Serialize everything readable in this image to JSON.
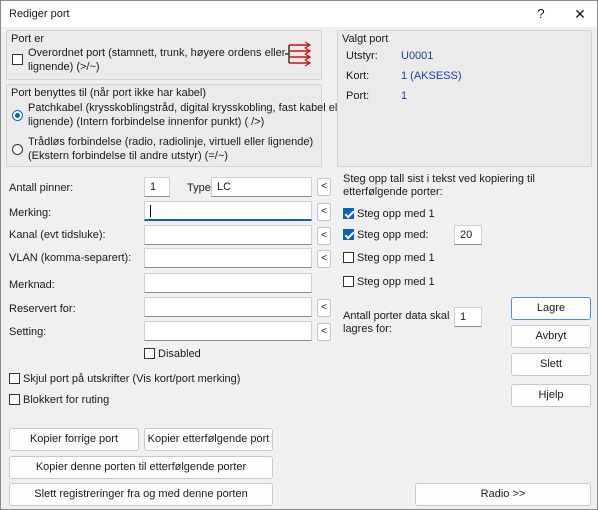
{
  "window": {
    "title": "Rediger port",
    "help": "?",
    "close": "✕"
  },
  "port_er": {
    "legend": "Port er",
    "overordnet_label": "Overordnet port (stamnett, trunk, høyere ordens eller lignende) (>/~)",
    "overordnet_line1": "Overordnet port (stamnett, trunk, høyere ordens eller",
    "overordnet_line2": "lignende) (>/~)"
  },
  "benyttes": {
    "legend": "Port benyttes til (når port ikke har kabel)",
    "patch_line1": "Patchkabel (krysskoblingstråd, digital krysskobling, fast kabel eller",
    "patch_line2": "lignende) (Intern forbindelse innenfor punkt) ( />)",
    "wireless_line1": "Trådløs forbindelse (radio, radiolinje, virtuell eller lignende)",
    "wireless_line2": "(Ekstern forbindelse til andre utstyr) (=/~)",
    "selected": "patch"
  },
  "valgt_port": {
    "legend": "Valgt port",
    "utstyr_label": "Utstyr:",
    "utstyr_value": "U0001",
    "kort_label": "Kort:",
    "kort_value": "1  (AKSESS)",
    "port_label": "Port:",
    "port_value": "1"
  },
  "fields": {
    "antall_pinner_label": "Antall pinner:",
    "antall_pinner_value": "1",
    "type_label": "Type:",
    "type_value": "LC",
    "merking_label": "Merking:",
    "merking_value": "",
    "kanal_label": "Kanal (evt tidsluke):",
    "kanal_value": "",
    "vlan_label": "VLAN (komma-separert):",
    "vlan_value": "",
    "merknad_label": "Merknad:",
    "merknad_value": "",
    "reservert_label": "Reservert for:",
    "reservert_value": "",
    "setting_label": "Setting:",
    "setting_value": "",
    "lt": "<",
    "disabled_label": "Disabled"
  },
  "steg": {
    "header_line1": "Steg opp tall sist i tekst ved kopiering til",
    "header_line2": "etterfølgende porter:",
    "items": [
      {
        "label": "Steg opp med 1",
        "checked": true
      },
      {
        "label": "Steg opp med:",
        "checked": true,
        "value": "20"
      },
      {
        "label": "Steg opp med 1",
        "checked": false
      },
      {
        "label": "Steg opp med 1",
        "checked": false
      }
    ],
    "antall_line1": "Antall porter data skal",
    "antall_line2": "lagres for:",
    "antall_value": "1"
  },
  "options": {
    "skjul_label": "Skjul port på utskrifter (Vis kort/port merking)",
    "blokkert_label": "Blokkert for ruting"
  },
  "buttons": {
    "lagre": "Lagre",
    "avbryt": "Avbryt",
    "slett": "Slett",
    "hjelp": "Hjelp",
    "kopier_forrige": "Kopier forrige port",
    "kopier_etterfolgende": "Kopier etterfølgende port",
    "kopier_til": "Kopier denne porten til etterfølgende porter",
    "slett_registreringer": "Slett registreringer fra og med denne porten",
    "radio": "Radio >>"
  },
  "colors": {
    "accent": "#0a5fbf",
    "value_text": "#1a3f9f",
    "arrow_icon": "#d01010"
  },
  "icons": {
    "trunk": "trunk-arrows-icon"
  }
}
